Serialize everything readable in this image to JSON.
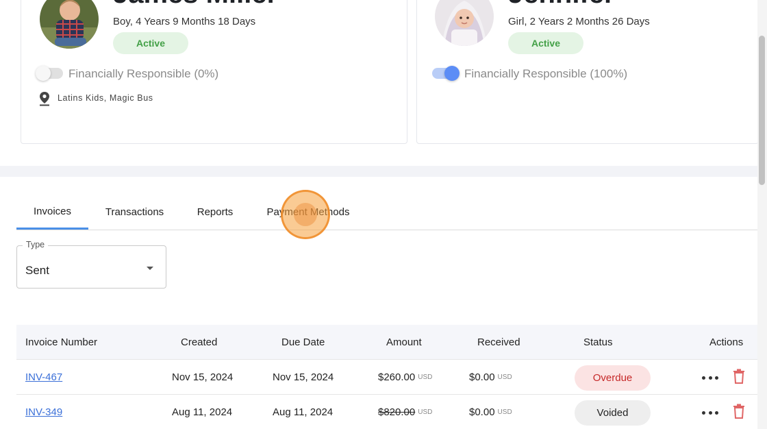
{
  "children": [
    {
      "name": "James Miller",
      "summary": "Boy, 4 Years 9 Months 18 Days",
      "status": "Active",
      "financially_responsible": "Financially Responsible (0%)",
      "responsible_on": false,
      "locations": "Latins Kids, Magic Bus",
      "avatar_icon": "child-photo"
    },
    {
      "name": "Jennifer",
      "summary": "Girl, 2 Years 2 Months 26 Days",
      "status": "Active",
      "financially_responsible": "Financially Responsible (100%)",
      "responsible_on": true,
      "avatar_icon": "baby-photo"
    }
  ],
  "tabs": [
    {
      "label": "Invoices",
      "active": true
    },
    {
      "label": "Transactions",
      "active": false
    },
    {
      "label": "Reports",
      "active": false
    },
    {
      "label": "Payment Methods",
      "active": false
    }
  ],
  "filter": {
    "type_label": "Type",
    "type_value": "Sent"
  },
  "table": {
    "headers": [
      "Invoice Number",
      "Created",
      "Due Date",
      "Amount",
      "Received",
      "Status",
      "Actions"
    ],
    "rows": [
      {
        "invoice": "INV-467",
        "created": "Nov 15, 2024",
        "due": "Nov 15, 2024",
        "amount": "$260.00",
        "amount_currency": "USD",
        "received": "$0.00",
        "received_currency": "USD",
        "status": "Overdue"
      },
      {
        "invoice": "INV-349",
        "created": "Aug 11, 2024",
        "due": "Aug 11, 2024",
        "amount": "$820.00",
        "amount_currency": "USD",
        "received": "$0.00",
        "received_currency": "USD",
        "status": "Voided"
      }
    ]
  },
  "colors": {
    "accent": "#4a8fe7",
    "link": "#3a6fd8",
    "active_badge_bg": "#e4f4e4",
    "active_badge_text": "#43a047",
    "overdue_bg": "#fbe3e3",
    "overdue_text": "#c62828",
    "voided_bg": "#eeeeee",
    "delete": "#e06666"
  }
}
